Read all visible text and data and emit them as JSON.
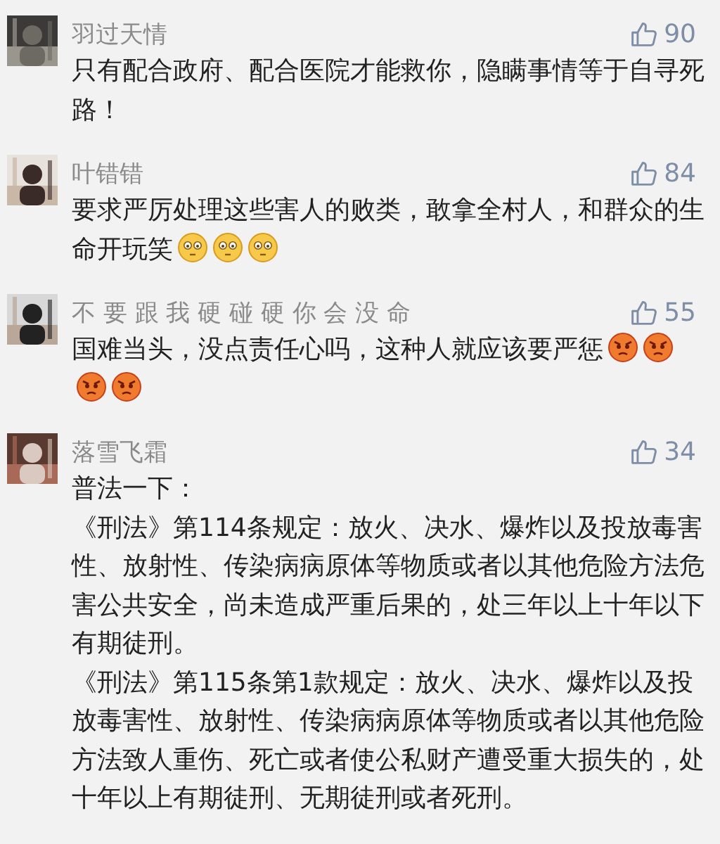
{
  "comments": [
    {
      "avatar": {
        "kind": "picture"
      },
      "name": "羽过天情",
      "likes": "90",
      "paragraphs": [
        "只有配合政府、配合医院才能救你，隐瞒事情等于自寻死路！"
      ]
    },
    {
      "avatar": {
        "kind": "picture"
      },
      "name": "叶错错",
      "likes": "84",
      "paragraphs": [
        "要求严厉处理这些害人的败类，敢拿全村人，和群众的生命开玩笑"
      ],
      "emojis": [
        {
          "kind": "dizzy"
        },
        {
          "kind": "dizzy"
        },
        {
          "kind": "dizzy"
        }
      ]
    },
    {
      "avatar": {
        "kind": "picture"
      },
      "name": "不 要 跟 我 硬 碰 硬 你 会 没 命",
      "likes": "55",
      "paragraphs": [
        "国难当头，没点责任心吗，这种人就应该要严惩"
      ],
      "emojis": [
        {
          "kind": "angry"
        },
        {
          "kind": "angry"
        },
        {
          "kind": "angry"
        },
        {
          "kind": "angry"
        }
      ]
    },
    {
      "avatar": {
        "kind": "picture"
      },
      "name": "落雪飞霜",
      "likes": "34",
      "paragraphs": [
        "普法一下：",
        "《刑法》第114条规定：放火、决水、爆炸以及投放毒害性、放射性、传染病病原体等物质或者以其他危险方法危害公共安全，尚未造成严重后果的，处三年以上十年以下有期徒刑。",
        "《刑法》第115条第1款规定：放火、决水、爆炸以及投放毒害性、放射性、传染病病原体等物质或者以其他危险方法致人重伤、死亡或者使公私财产遭受重大损失的，处十年以上有期徒刑、无期徒刑或者死刑。"
      ]
    }
  ]
}
